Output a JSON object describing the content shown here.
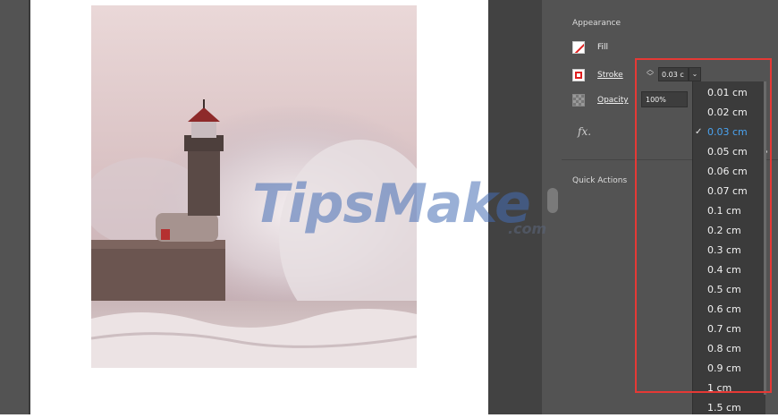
{
  "appearance": {
    "title": "Appearance",
    "fill_label": "Fill",
    "stroke_label": "Stroke",
    "stroke_value": "0.03 c",
    "opacity_label": "Opacity",
    "opacity_value": "100%",
    "fx_label": "fx."
  },
  "quick_actions": {
    "title": "Quick Actions"
  },
  "stroke_dropdown": {
    "selected": "0.03 cm",
    "options": [
      "0.01 cm",
      "0.02 cm",
      "0.03 cm",
      "0.05 cm",
      "0.06 cm",
      "0.07 cm",
      "0.1 cm",
      "0.2 cm",
      "0.3 cm",
      "0.4 cm",
      "0.5 cm",
      "0.6 cm",
      "0.7 cm",
      "0.8 cm",
      "0.9 cm",
      "1 cm",
      "1.5 cm"
    ]
  },
  "watermark": {
    "main": "TipsMake",
    "sub": ".com"
  },
  "colors": {
    "panel_bg": "#535353",
    "dropdown_bg": "#3b3b3b",
    "highlight_red": "#e53935",
    "selected_blue": "#4aa3f0"
  }
}
